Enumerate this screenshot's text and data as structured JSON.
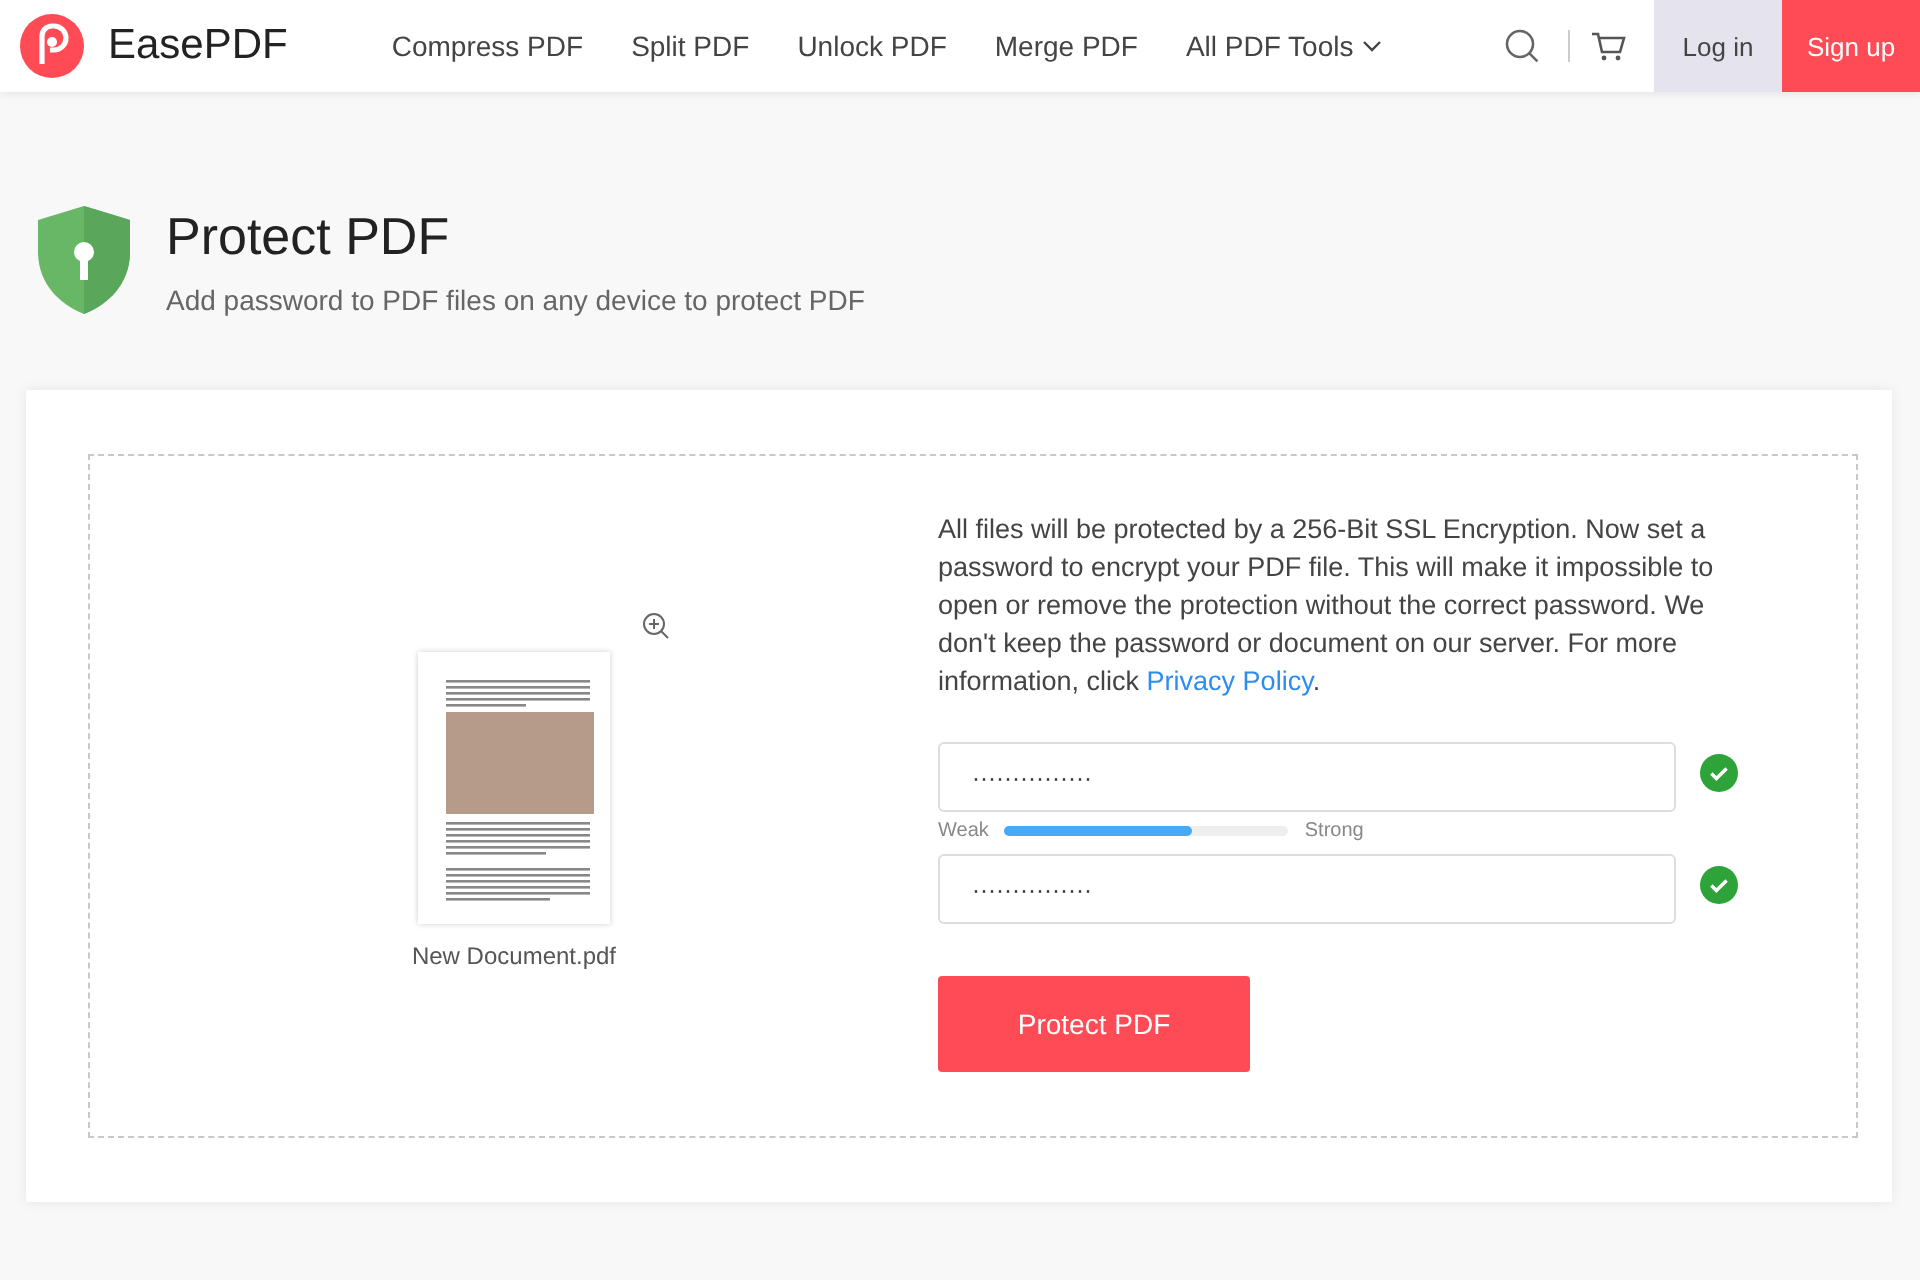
{
  "header": {
    "brand": "EasePDF",
    "nav": [
      {
        "label": "Compress PDF",
        "kind": "link"
      },
      {
        "label": "Split PDF",
        "kind": "link"
      },
      {
        "label": "Unlock PDF",
        "kind": "link"
      },
      {
        "label": "Merge PDF",
        "kind": "link"
      },
      {
        "label": "All PDF Tools",
        "kind": "dropdown"
      }
    ],
    "login": "Log in",
    "signup": "Sign up"
  },
  "page": {
    "title": "Protect PDF",
    "subtitle": "Add password to PDF files on any device to protect PDF"
  },
  "file": {
    "name": "New Document.pdf"
  },
  "info": {
    "text": "All files will be protected by a 256-Bit SSL Encryption. Now set a password to encrypt your PDF file. This will make it impossible to open or remove the protection without the correct password. We don't keep the password or document on our server. For more information, click ",
    "link": "Privacy Policy",
    "end": "."
  },
  "password": {
    "value": "···············",
    "valid": true
  },
  "strength": {
    "low": "Weak",
    "high": "Strong",
    "level": 0.66
  },
  "confirm": {
    "value": "···············",
    "valid": true
  },
  "button": "Protect PDF"
}
